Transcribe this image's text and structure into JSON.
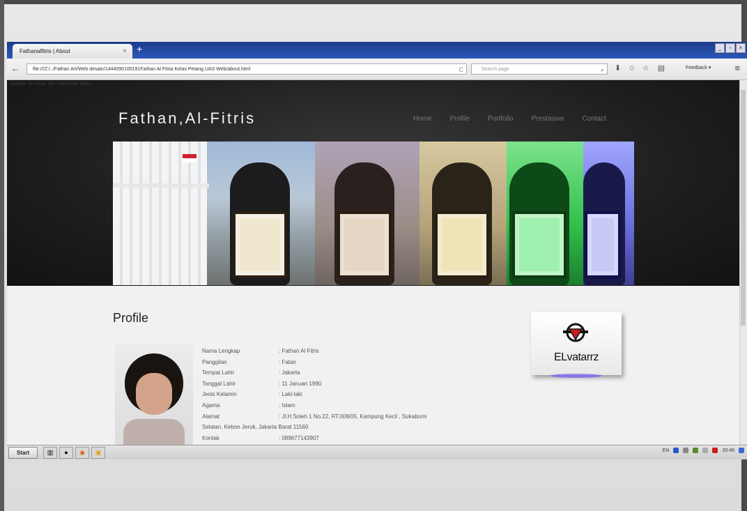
{
  "browser": {
    "tab_title": "Fathanalfitris | About",
    "tab_close": "×",
    "new_tab": "+",
    "window_controls": [
      "_",
      "▫",
      "×"
    ],
    "back": "←",
    "url": "file:///Z:/../Fathan Art/Web desain/1444090100191Fathan Al Fitria Kelas Petang UAS Web/about.html",
    "reload": "C",
    "search_placeholder": "Search page",
    "feedback_label": "Feedback",
    "menu_icon": "≡"
  },
  "site": {
    "header_ghost_text": "Sumber by Hikai. 3D. Fig Cover Hiam",
    "title": "Fathan,Al-Fitris",
    "nav": [
      "Home",
      "Profile",
      "Portfolio",
      "Prestasive",
      "Contact"
    ]
  },
  "profile": {
    "heading": "Profile",
    "rows": [
      {
        "key": "Nama Lengkap",
        "value": ": Fathan Al Fitris"
      },
      {
        "key": "Panggilan",
        "value": ": Fatan"
      },
      {
        "key": "Tempat Lahir",
        "value": ": Jakarta"
      },
      {
        "key": "Tanggal Lahir",
        "value": ": 11 Januari 1990"
      },
      {
        "key": "Jenis Kelamin",
        "value": ": Laki-laki"
      },
      {
        "key": "Agama",
        "value": ": Islam"
      },
      {
        "key": "Alamat",
        "value": ": Jl.H.Soleh 1 No.22, RT.008/05, Kampung Kecil , Sukabumi"
      },
      {
        "key": "Kontak",
        "value": ": 089677143907"
      }
    ],
    "address_line2": "Selatan, Kebon Jeruk, Jakarta Barat 11560",
    "logo_text": "ELvatarrz"
  },
  "taskbar": {
    "start": "Start",
    "tray_lang": "EN",
    "tray_time": "20:46"
  }
}
